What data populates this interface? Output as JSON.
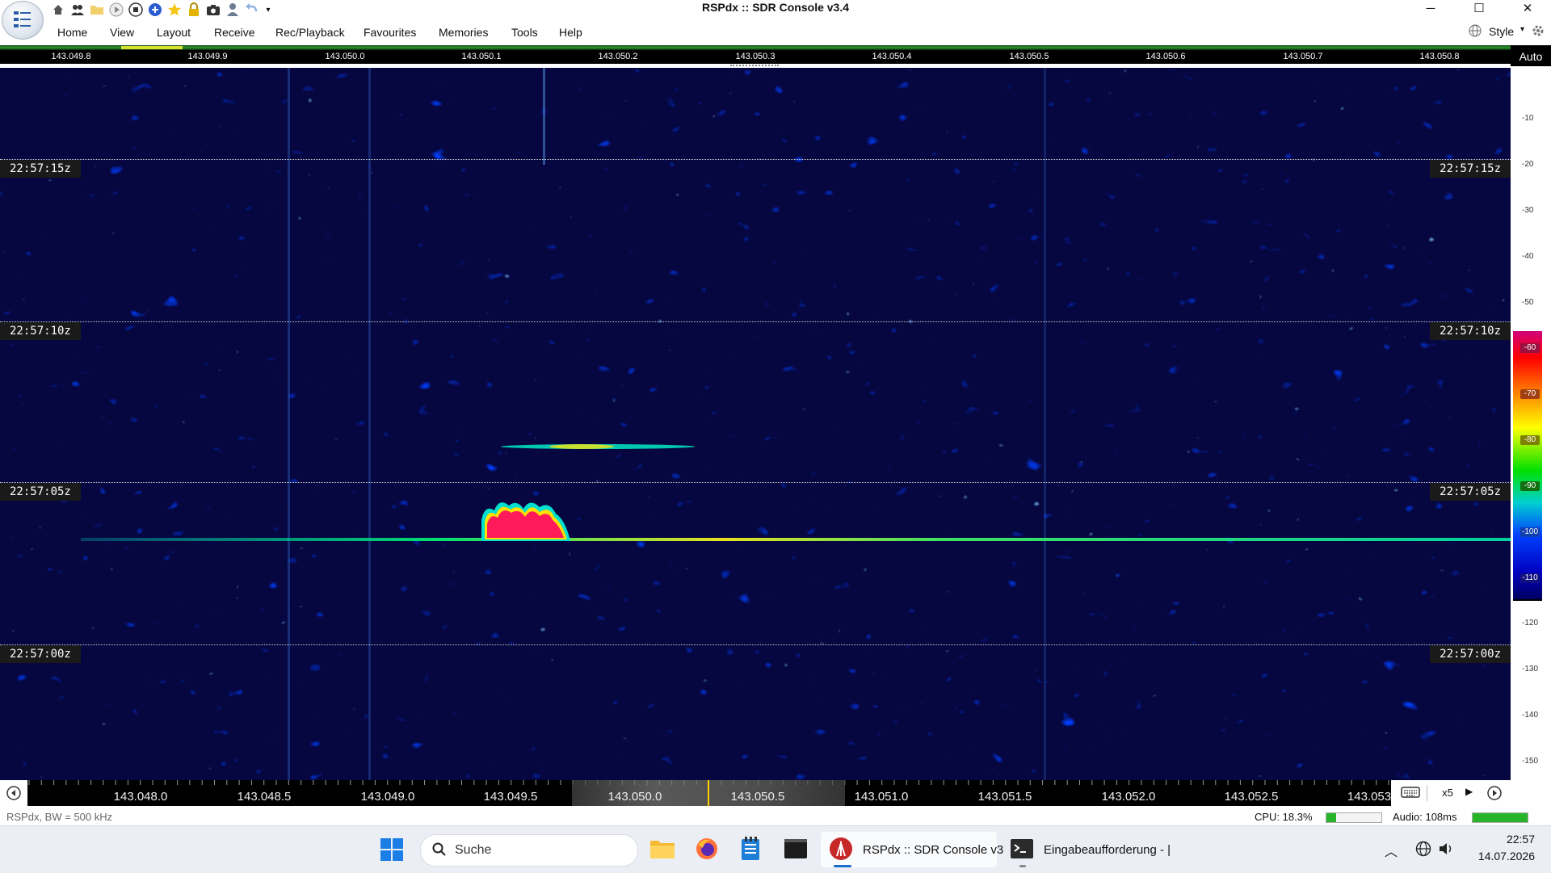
{
  "window": {
    "title": "RSPdx :: SDR Console v3.4",
    "controls": {
      "minimize": "─",
      "maximize": "☐",
      "close": "✕"
    }
  },
  "quick_access": [
    "home-icon",
    "users-icon",
    "folder-icon",
    "play-icon",
    "stop-icon",
    "add-icon",
    "star-icon",
    "lock-icon",
    "camera-icon",
    "person-icon",
    "undo-icon",
    "dropdown-icon"
  ],
  "menu": [
    "Home",
    "View",
    "Layout",
    "Receive",
    "Rec/Playback",
    "Favourites",
    "Memories",
    "Tools",
    "Help"
  ],
  "style_label": "Style",
  "freq_ruler": [
    "143.049.8",
    "143.049.9",
    "143.050.0",
    "143.050.1",
    "143.050.2",
    "143.050.3",
    "143.050.4",
    "143.050.5",
    "143.050.6",
    "143.050.7",
    "143.050.8"
  ],
  "right_panel": {
    "auto_label": "Auto",
    "db_ticks_plain": [
      "-10",
      "-20",
      "-30",
      "-40",
      "-50",
      "-120",
      "-130",
      "-140",
      "-150"
    ],
    "db_ticks_color": [
      "-60",
      "-70",
      "-80",
      "-90",
      "-100",
      "-110"
    ],
    "colors": {
      "red": "#ff0000",
      "orange": "#ff8c00",
      "yellow": "#ffff00",
      "green": "#00e000",
      "cyan": "#00d0d0",
      "blue": "#0040ff",
      "navy": "#000060",
      "magenta": "#d0007a"
    }
  },
  "waterfall": {
    "timestamps": [
      "22:57:15z",
      "22:57:10z",
      "22:57:05z",
      "22:57:00z"
    ],
    "background_color": "#0a0a4e",
    "signal_color": "#00e070",
    "burst_color": "#ff1a5a"
  },
  "bottom_scale": {
    "labels": [
      "143.048.0",
      "143.048.5",
      "143.049.0",
      "143.049.5",
      "143.050.0",
      "143.050.5",
      "143.051.0",
      "143.051.5",
      "143.052.0",
      "143.052.5",
      "143.053"
    ],
    "zoom_label": "x5"
  },
  "status": {
    "left": "RSPdx, BW = 500 kHz",
    "cpu": "CPU: 18.3%",
    "cpu_level": 0.183,
    "audio": "Audio: 108ms",
    "audio_level": 1.0
  },
  "taskbar": {
    "search_placeholder": "Suche",
    "apps": [
      {
        "label": "RSPdx :: SDR Console v3",
        "icon": "sdr-console-icon"
      },
      {
        "label": "Eingabeaufforderung - |",
        "icon": "cmd-icon"
      }
    ],
    "time": "22:57",
    "date": "14.07.2026"
  }
}
